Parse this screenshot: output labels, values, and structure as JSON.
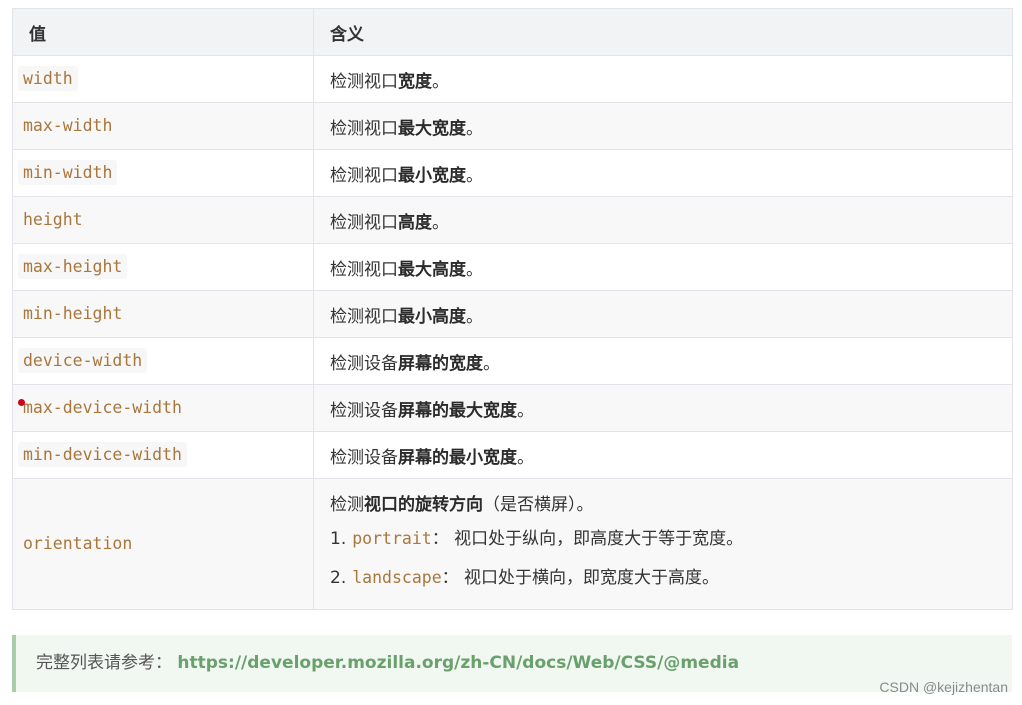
{
  "table": {
    "headers": [
      "值",
      "含义"
    ],
    "rows": [
      {
        "value": "width",
        "prefix": "检测视口",
        "bold": "宽度",
        "suffix": "。"
      },
      {
        "value": "max-width",
        "prefix": "检测视口",
        "bold": "最大宽度",
        "suffix": "。"
      },
      {
        "value": "min-width",
        "prefix": "检测视口",
        "bold": "最小宽度",
        "suffix": "。"
      },
      {
        "value": "height",
        "prefix": "检测视口",
        "bold": "高度",
        "suffix": "。"
      },
      {
        "value": "max-height",
        "prefix": "检测视口",
        "bold": "最大高度",
        "suffix": "。"
      },
      {
        "value": "min-height",
        "prefix": "检测视口",
        "bold": "最小高度",
        "suffix": "。"
      },
      {
        "value": "device-width",
        "prefix": "检测设备",
        "bold": "屏幕的宽度",
        "suffix": "。"
      },
      {
        "value": "max-device-width",
        "prefix": "检测设备",
        "bold": "屏幕的最大宽度",
        "suffix": "。"
      },
      {
        "value": "min-device-width",
        "prefix": "检测设备",
        "bold": "屏幕的最小宽度",
        "suffix": "。"
      }
    ],
    "orientation": {
      "value": "orientation",
      "prefix": "检测",
      "bold": "视口的旋转方向",
      "suffix": "（是否横屏）。",
      "items": [
        {
          "num": "1.",
          "code": "portrait",
          "text": "： 视口处于纵向，即高度大于等于宽度。"
        },
        {
          "num": "2.",
          "code": "landscape",
          "text": "： 视口处于横向，即宽度大于高度。"
        }
      ]
    }
  },
  "note": {
    "label": "完整列表请参考：",
    "link": "https://developer.mozilla.org/zh-CN/docs/Web/CSS/@media"
  },
  "watermark": "CSDN @kejizhentan",
  "colors": {
    "code": "#a9763c",
    "link": "#6aa06c",
    "note_bg": "#f1f8f2",
    "note_border": "#a7cdaa",
    "marker": "#d0021b"
  }
}
